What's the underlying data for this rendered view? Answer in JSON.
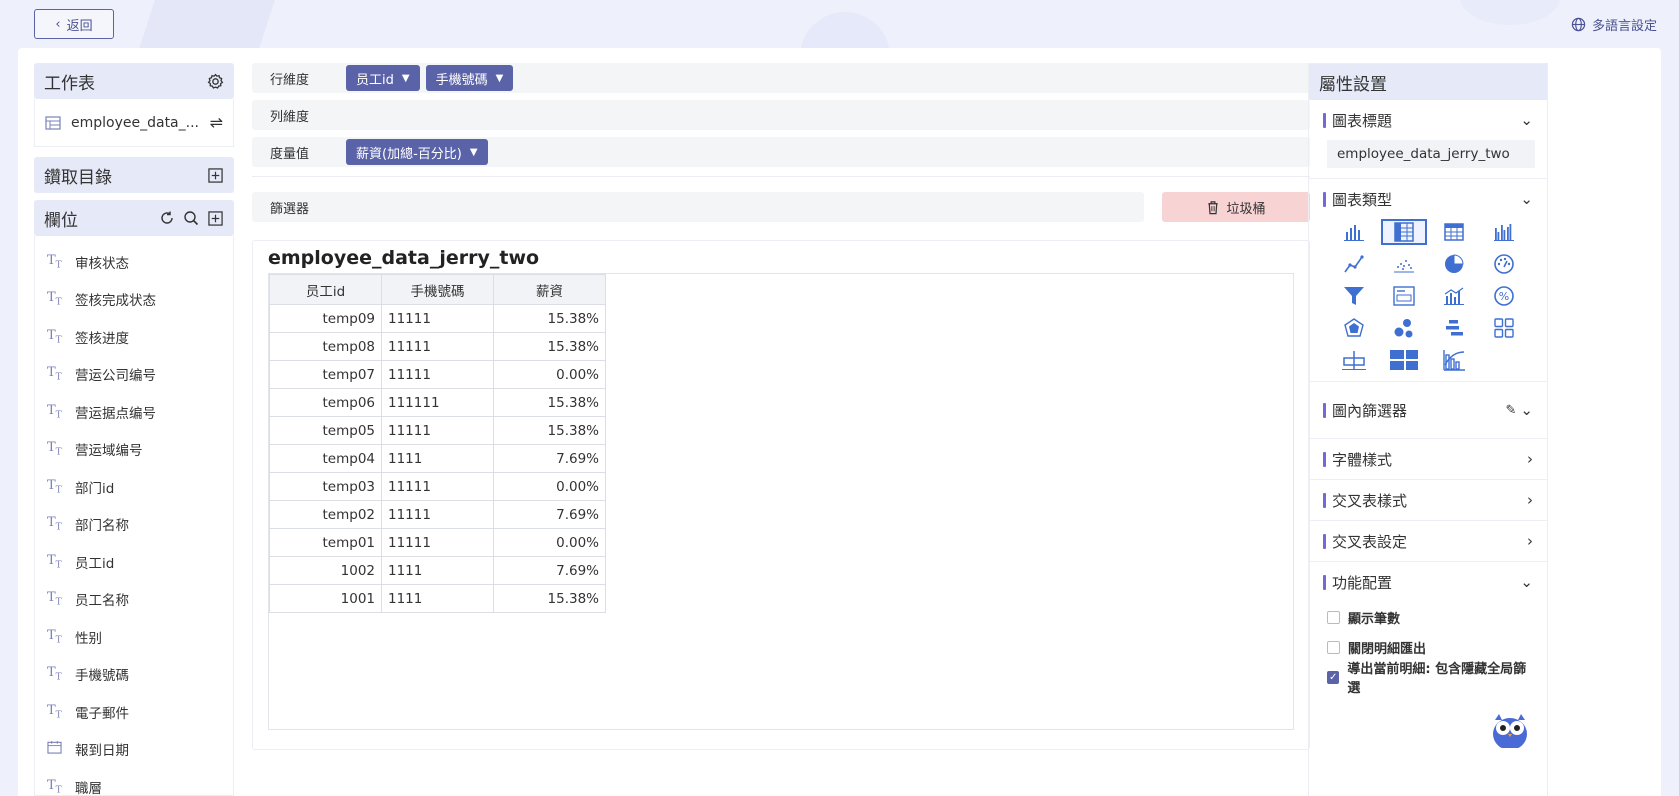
{
  "header": {
    "back_label": "返回",
    "lang_label": "多語言設定"
  },
  "left": {
    "worksheet_title": "工作表",
    "worksheet_item": "employee_data_...",
    "catalog_title": "鑽取目錄",
    "fields_title": "欄位",
    "fields": [
      "审核状态",
      "签核完成状态",
      "签核进度",
      "营运公司编号",
      "营运据点编号",
      "营运域编号",
      "部门id",
      "部门名称",
      "员工id",
      "员工名称",
      "性别",
      "手機號碼",
      "電子郵件",
      "報到日期",
      "職層"
    ]
  },
  "center": {
    "row_dim_label": "行維度",
    "row_chips": [
      "员工id",
      "手機號碼"
    ],
    "col_dim_label": "列維度",
    "measure_label": "度量值",
    "measure_chips": [
      "薪資(加總-百分比)"
    ],
    "filter_label": "篩選器",
    "trash_label": "垃圾桶",
    "chart_title": "employee_data_jerry_two",
    "table": {
      "headers": [
        "员工id",
        "手機號碼",
        "薪資"
      ],
      "rows": [
        [
          "temp09",
          "11111",
          "15.38%"
        ],
        [
          "temp08",
          "11111",
          "15.38%"
        ],
        [
          "temp07",
          "11111",
          "0.00%"
        ],
        [
          "temp06",
          "111111",
          "15.38%"
        ],
        [
          "temp05",
          "11111",
          "15.38%"
        ],
        [
          "temp04",
          "1111",
          "7.69%"
        ],
        [
          "temp03",
          "11111",
          "0.00%"
        ],
        [
          "temp02",
          "11111",
          "7.69%"
        ],
        [
          "temp01",
          "11111",
          "0.00%"
        ],
        [
          "1002",
          "1111",
          "7.69%"
        ],
        [
          "1001",
          "1111",
          "15.38%"
        ]
      ]
    }
  },
  "right": {
    "title": "屬性設置",
    "chart_title_section": "圖表標題",
    "chart_title_value": "employee_data_jerry_two",
    "chart_type_section": "圖表類型",
    "inner_filter_section": "圖內篩選器",
    "font_style_section": "字體樣式",
    "cross_style_section": "交叉表樣式",
    "cross_setting_section": "交叉表設定",
    "func_section": "功能配置",
    "options": [
      {
        "label": "顯示筆數",
        "checked": false
      },
      {
        "label": "關閉明細匯出",
        "checked": false
      },
      {
        "label": "導出當前明細: 包含隱藏全局篩選",
        "checked": true
      }
    ]
  },
  "colors": {
    "accent": "#5b63a8",
    "chart_icon": "#3f6fd1",
    "trash_bg": "#f8d3d3"
  }
}
